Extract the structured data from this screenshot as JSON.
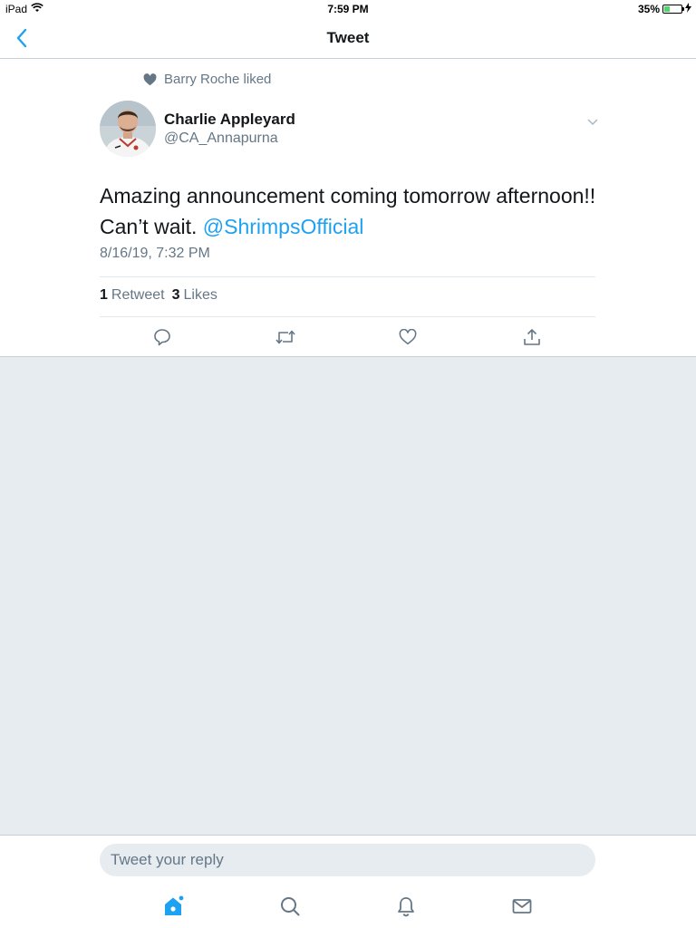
{
  "status_bar": {
    "device": "iPad",
    "time": "7:59 PM",
    "battery": "35%",
    "battery_level": 0.35
  },
  "nav": {
    "title": "Tweet"
  },
  "social_context": {
    "text": "Barry Roche liked"
  },
  "tweet": {
    "author_name": "Charlie Appleyard",
    "author_handle": "@CA_Annapurna",
    "text_line1": "Amazing announcement coming tomorrow afternoon!!",
    "text_line2_prefix": "Can’t wait. ",
    "mention": "@ShrimpsOfficial",
    "timestamp": "8/16/19, 7:32 PM",
    "retweet_count": "1",
    "retweet_label": "Retweet",
    "like_count": "3",
    "like_label": "Likes"
  },
  "reply": {
    "placeholder": "Tweet your reply"
  },
  "icons": {
    "back": "chevron-left-icon",
    "caret": "chevron-down-icon",
    "reply": "comment-icon",
    "retweet": "retweet-icon",
    "like": "heart-icon",
    "share": "share-icon",
    "home": "home-icon",
    "search": "search-icon",
    "notifications": "bell-icon",
    "messages": "mail-icon"
  },
  "colors": {
    "accent": "#1da1f2",
    "text_secondary": "#657786",
    "background": "#e6ecf0"
  }
}
